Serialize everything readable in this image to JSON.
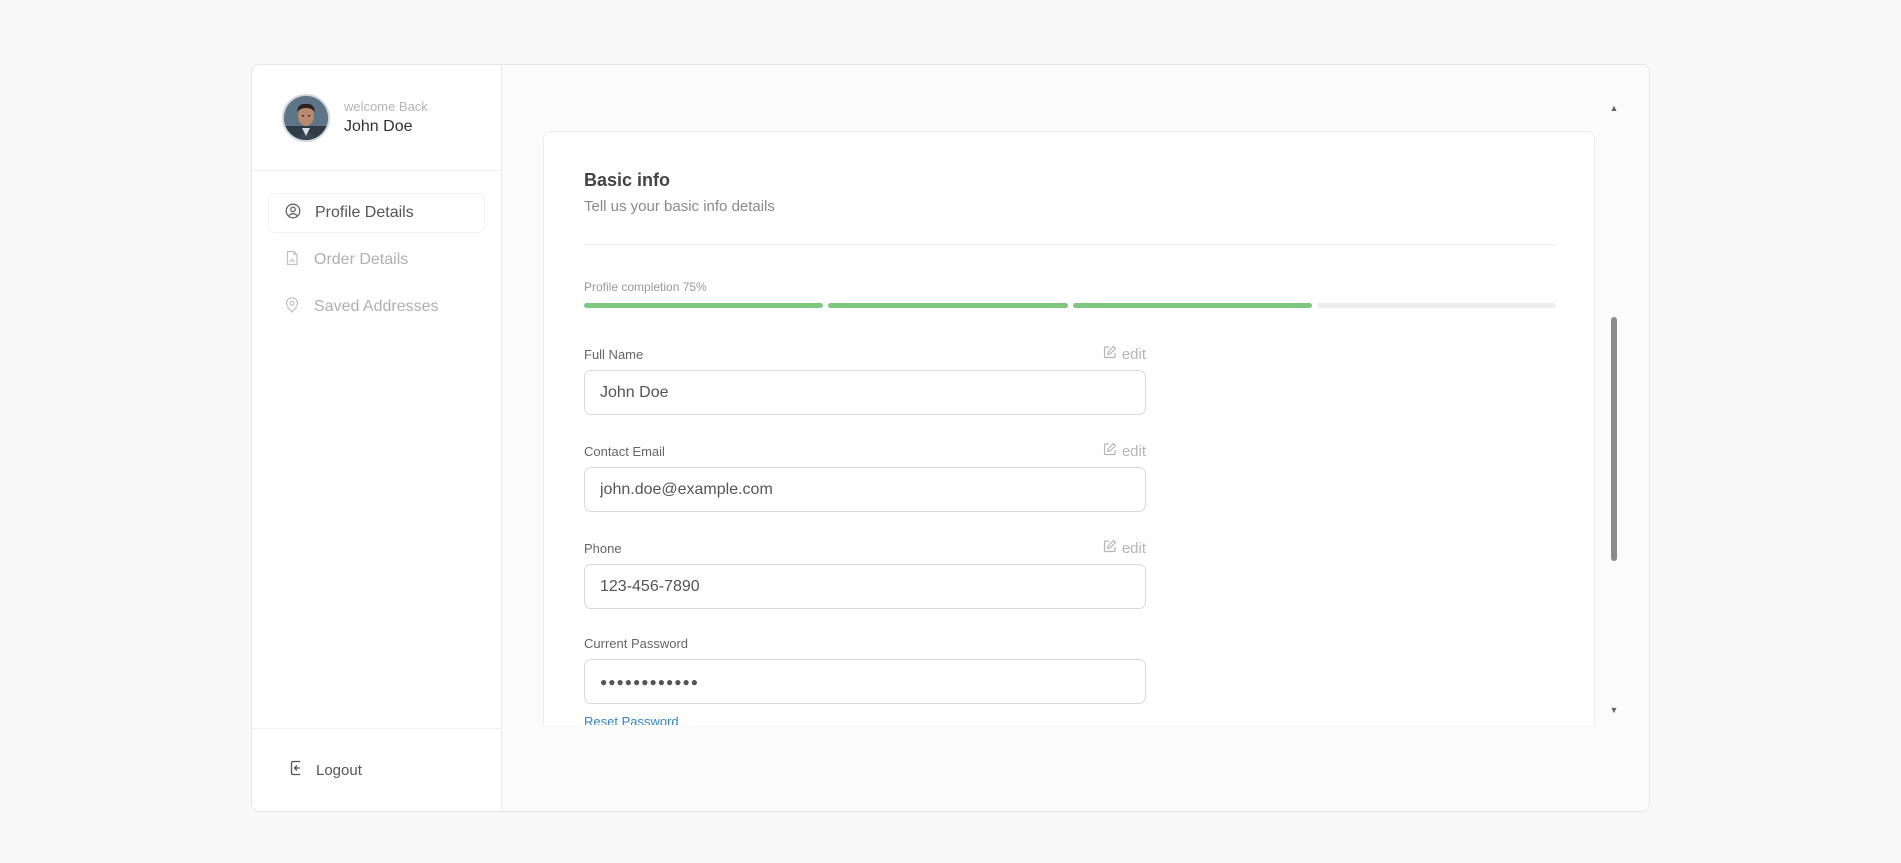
{
  "user": {
    "greeting": "welcome Back",
    "name": "John Doe"
  },
  "sidebar": {
    "items": [
      {
        "label": "Profile Details",
        "icon": "user-circle-icon",
        "active": true
      },
      {
        "label": "Order Details",
        "icon": "document-icon",
        "active": false
      },
      {
        "label": "Saved Addresses",
        "icon": "map-pin-icon",
        "active": false
      }
    ],
    "logout_label": "Logout"
  },
  "card": {
    "title": "Basic info",
    "subtitle": "Tell us your basic info details",
    "progress_label": "Profile completion 75%",
    "progress_fraction": 0.75,
    "progress_segments_total": 4,
    "progress_segments_filled": 3
  },
  "fields": {
    "full_name": {
      "label": "Full Name",
      "value": "John Doe",
      "edit_label": "edit"
    },
    "email": {
      "label": "Contact Email",
      "value": "john.doe@example.com",
      "edit_label": "edit"
    },
    "phone": {
      "label": "Phone",
      "value": "123-456-7890",
      "edit_label": "edit"
    },
    "password": {
      "label": "Current Password",
      "value": "●●●●●●●●●●●●"
    }
  },
  "reset_password_label": "Reset Password",
  "colors": {
    "progress_filled": "#7dc87e",
    "progress_empty": "#eeeeee",
    "link": "#2f86d6"
  }
}
